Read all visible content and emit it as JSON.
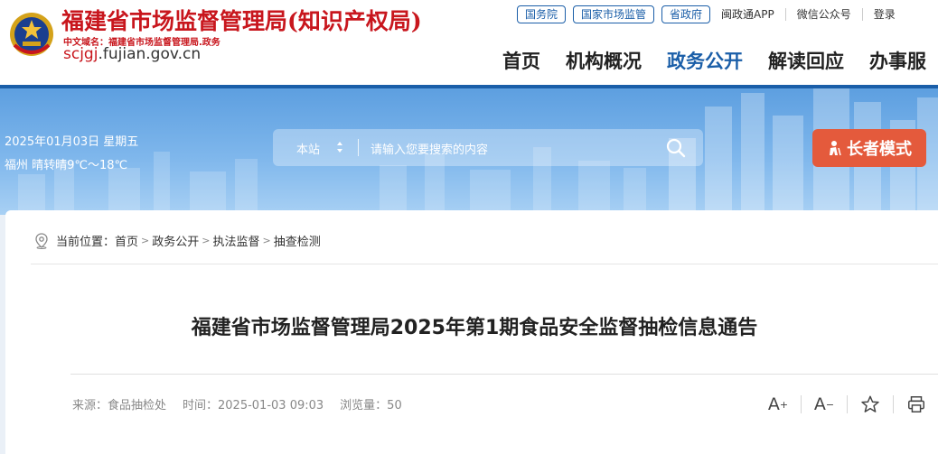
{
  "header": {
    "title": "福建省市场监督管理局(知识产权局)",
    "domain_cn": "中文域名：福建省市场监督管理局.政务",
    "domain_en_prefix": "scjgj",
    "domain_en_rest": ".fujian.gov.cn",
    "top_links": [
      "国务院",
      "国家市场监管",
      "省政府"
    ],
    "top_plain": [
      "闽政通APP",
      "微信公众号",
      "登录"
    ],
    "nav": [
      "首页",
      "机构概况",
      "政务公开",
      "解读回应",
      "办事服"
    ],
    "active_nav": "政务公开"
  },
  "banner": {
    "date": "2025年01月03日 星期五",
    "weather": "福州 晴转晴9℃～18℃",
    "search_scope": "本站",
    "search_placeholder": "请输入您要搜索的内容",
    "elder_mode": "长者模式"
  },
  "breadcrumb": {
    "label": "当前位置：",
    "items": [
      "首页",
      "政务公开",
      "执法监督",
      "抽查检测"
    ]
  },
  "article": {
    "title": "福建省市场监督管理局2025年第1期食品安全监督抽检信息通告",
    "source": "来源：食品抽检处",
    "time": "时间：2025-01-03 09:03",
    "views": "浏览量：50"
  },
  "tools": {
    "font_up": "A",
    "font_down": "A"
  },
  "colors": {
    "brand_red": "#c8161d",
    "nav_blue": "#1a5ea8",
    "elder_orange": "#e45a3c"
  }
}
